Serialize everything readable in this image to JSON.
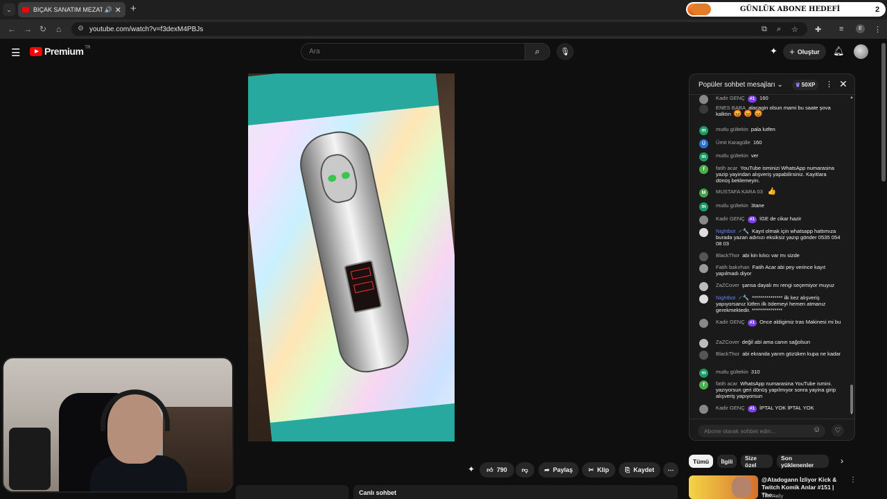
{
  "browser": {
    "tab_title": "BIÇAK SANATIM MEZAT ka",
    "url": "youtube.com/watch?v=f3dexM4PBJs",
    "profile_initial": "E"
  },
  "goal_widget": {
    "count": "0",
    "label": "GÜNLÜK ABONE HEDEFİ",
    "target": "2"
  },
  "header": {
    "logo_text": "Premium",
    "logo_region": "TR",
    "search_placeholder": "Ara",
    "create_label": "Oluştur"
  },
  "actions": {
    "likes": "790",
    "share": "Paylaş",
    "clip": "Klip",
    "save": "Kaydet"
  },
  "live_chat_tab": "Canlı sohbet",
  "chat": {
    "title": "Popüler sohbet mesajları",
    "xp": "50XP",
    "input_placeholder": "Abone olarak sohbet edin...",
    "messages": [
      {
        "author": "Kadir GENÇ",
        "rank": "#1",
        "text": "160",
        "av": "",
        "avcolor": "#888"
      },
      {
        "author": "ENES BABA",
        "rank": "",
        "text": "alacagin olsun mami bu saate şova kalktın",
        "emoji": "😡 😡 😡",
        "av": "",
        "avcolor": "#3a3a3a"
      },
      {
        "author": "mutlu gültekin",
        "rank": "",
        "text": "pala lutfen",
        "av": "m",
        "avcolor": "#1e9a66"
      },
      {
        "author": "Ümit Karagülle",
        "rank": "",
        "text": "160",
        "av": "Ü",
        "avcolor": "#2b6fd6"
      },
      {
        "author": "mutlu gültekin",
        "rank": "",
        "text": "ver",
        "av": "m",
        "avcolor": "#1e9a66"
      },
      {
        "author": "fatih acar",
        "rank": "",
        "text": "YouTube isminizi WhatsApp numarasina yazip yayindan alışveriş yapabilirsiniz. Kayitlara dönüş beklemeyin.",
        "av": "f",
        "avcolor": "#4caf50"
      },
      {
        "author": "MUSTAFA KARA 03",
        "rank": "",
        "text": "",
        "emoji": "👍",
        "av": "M",
        "avcolor": "#43a047"
      },
      {
        "author": "mutlu gültekin",
        "rank": "",
        "text": "3tane",
        "av": "m",
        "avcolor": "#1e9a66"
      },
      {
        "author": "Kadir GENÇ",
        "rank": "#1",
        "text": "İGE de cikar hazir",
        "av": "",
        "avcolor": "#888"
      },
      {
        "author": "Nightbot",
        "mod": true,
        "rank": "",
        "text": "Kayıt olmak için whatsapp hattımıza burada yazan adınızı eksiksiz yazıp gönder 0535 054 08 03",
        "av": "",
        "avcolor": "#ddd"
      },
      {
        "author": "BlackThor",
        "rank": "",
        "text": "abi kin kılıcı var mı sizde",
        "av": "",
        "avcolor": "#555"
      },
      {
        "author": "Fatih bakırhan",
        "rank": "",
        "text": "Fatih Acar abi pey verince kayıt yapılmadı diyor",
        "av": "",
        "avcolor": "#999"
      },
      {
        "author": "ZaZCover",
        "rank": "",
        "text": "şansa dayalı mı rengi seçemiyor muyuz",
        "av": "",
        "avcolor": "#bbb"
      },
      {
        "author": "Nightbot",
        "mod": true,
        "rank": "",
        "text": "*************** ilk kez alışveriş yapıyorsanız lütfen ilk ödemeyi hemen atmanız gerekmektedir. ***************",
        "av": "",
        "avcolor": "#ddd"
      },
      {
        "author": "Kadir GENÇ",
        "rank": "#1",
        "text": "Once aldigimiz tras Makinesi mi bu",
        "av": "",
        "avcolor": "#888"
      },
      {
        "author": "ZaZCover",
        "rank": "",
        "text": "değil abi ama canın sağolsun",
        "av": "",
        "avcolor": "#bbb"
      },
      {
        "author": "BlackThor",
        "rank": "",
        "text": "abi ekranda yarım gözüken kupa ne kadar",
        "av": "",
        "avcolor": "#555"
      },
      {
        "author": "mutlu gültekin",
        "rank": "",
        "text": "310",
        "av": "m",
        "avcolor": "#1e9a66"
      },
      {
        "author": "fatih acar",
        "rank": "",
        "text": "WhatsApp numarasina YouTube ismini. yazıyorsun geri dönüş yapılmıyor sonra yayina girip alışveriş yapıyorsun",
        "av": "f",
        "avcolor": "#4caf50"
      },
      {
        "author": "Kadir GENÇ",
        "rank": "#1",
        "text": "İPTAL YOK İPTAL YOK",
        "av": "",
        "avcolor": "#888"
      }
    ]
  },
  "chips": [
    "Tümü",
    "İlgili",
    "Size özel",
    "Son yüklenenler"
  ],
  "recommendation": {
    "title": "@Atadogann İzliyor  Kick & Twitch Komik Anlar #151 | The...",
    "channel": "The Pally"
  }
}
